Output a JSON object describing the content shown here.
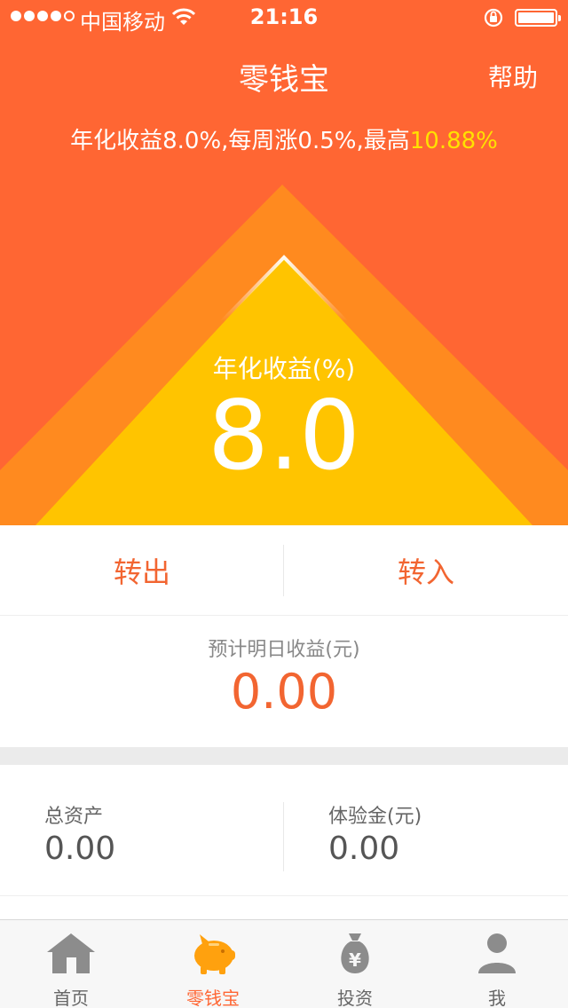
{
  "status_bar": {
    "carrier": "中国移动",
    "time": "21:16"
  },
  "nav": {
    "title": "零钱宝",
    "help": "帮助"
  },
  "promo": {
    "text": "年化收益8.0%,每周涨0.5%,最高",
    "highlight": "10.88%"
  },
  "rate": {
    "label": "年化收益(%)",
    "value": "8.0"
  },
  "actions": {
    "transfer_out": "转出",
    "transfer_in": "转入"
  },
  "forecast": {
    "label": "预计明日收益(元)",
    "value": "0.00"
  },
  "assets": {
    "total_label": "总资产",
    "total_value": "0.00",
    "trial_label": "体验金(元)",
    "trial_value": "0.00"
  },
  "tabs": [
    {
      "label": "首页",
      "icon": "home-icon"
    },
    {
      "label": "零钱宝",
      "icon": "piggy-bank-icon"
    },
    {
      "label": "投资",
      "icon": "money-bag-icon"
    },
    {
      "label": "我",
      "icon": "user-icon"
    }
  ],
  "colors": {
    "hero_bg": "#ff6633",
    "triangle_outer": "#ff8a1f",
    "triangle_inner": "#ffc400",
    "accent": "#f26531",
    "highlight": "#ffe100"
  }
}
